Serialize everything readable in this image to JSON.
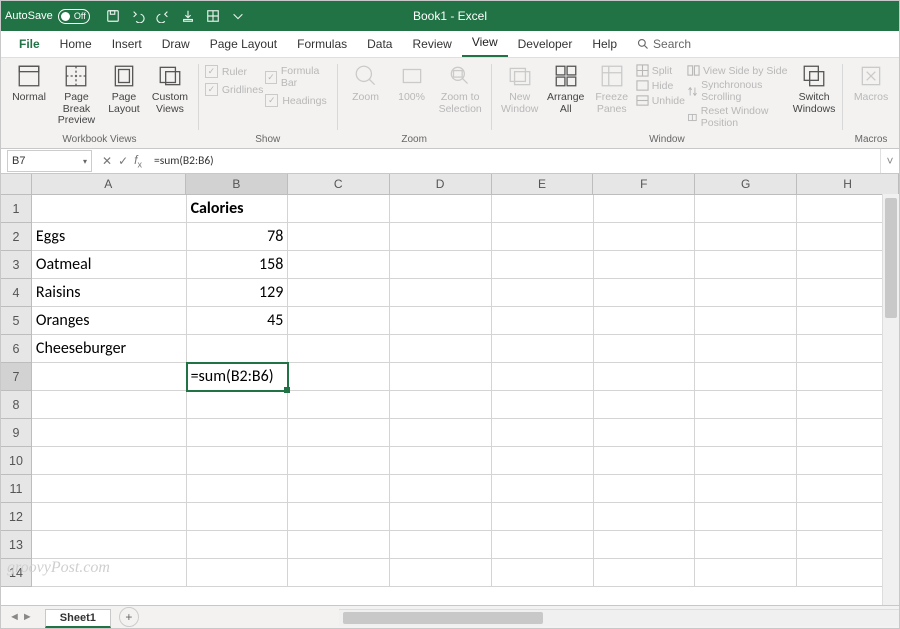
{
  "titlebar": {
    "autosave_label": "AutoSave",
    "autosave_state": "Off",
    "doc_title": "Book1  -  Excel"
  },
  "tabs": {
    "file": "File",
    "items": [
      "Home",
      "Insert",
      "Draw",
      "Page Layout",
      "Formulas",
      "Data",
      "Review",
      "View",
      "Developer",
      "Help"
    ],
    "active": "View",
    "search": "Search"
  },
  "ribbon": {
    "workbook_views": {
      "label": "Workbook Views",
      "normal": "Normal",
      "page_break": "Page Break\nPreview",
      "page_layout": "Page\nLayout",
      "custom_views": "Custom\nViews"
    },
    "show": {
      "label": "Show",
      "ruler": "Ruler",
      "gridlines": "Gridlines",
      "formula_bar": "Formula Bar",
      "headings": "Headings"
    },
    "zoom": {
      "label": "Zoom",
      "zoom": "Zoom",
      "hundred": "100%",
      "zoom_to_selection": "Zoom to\nSelection"
    },
    "window": {
      "label": "Window",
      "new_window": "New\nWindow",
      "arrange_all": "Arrange\nAll",
      "freeze_panes": "Freeze\nPanes",
      "split": "Split",
      "hide": "Hide",
      "unhide": "Unhide",
      "view_side": "View Side by Side",
      "sync_scroll": "Synchronous Scrolling",
      "reset_pos": "Reset Window Position",
      "switch_windows": "Switch\nWindows"
    },
    "macros": {
      "label": "Macros",
      "macros": "Macros"
    }
  },
  "namebox": "B7",
  "formula_bar": "=sum(B2:B6)",
  "columns": [
    "A",
    "B",
    "C",
    "D",
    "E",
    "F",
    "G",
    "H"
  ],
  "rows_visible": 14,
  "selected_cell": "B7",
  "cells": {
    "B1": "Calories",
    "A2": "Eggs",
    "B2": "78",
    "A3": "Oatmeal",
    "B3": "158",
    "A4": "Raisins",
    "B4": "129",
    "A5": "Oranges",
    "B5": "45",
    "A6": "Cheeseburger",
    "B7": "=sum(B2:B6)"
  },
  "sheets": {
    "active": "Sheet1"
  },
  "watermark": "groovyPost.com"
}
